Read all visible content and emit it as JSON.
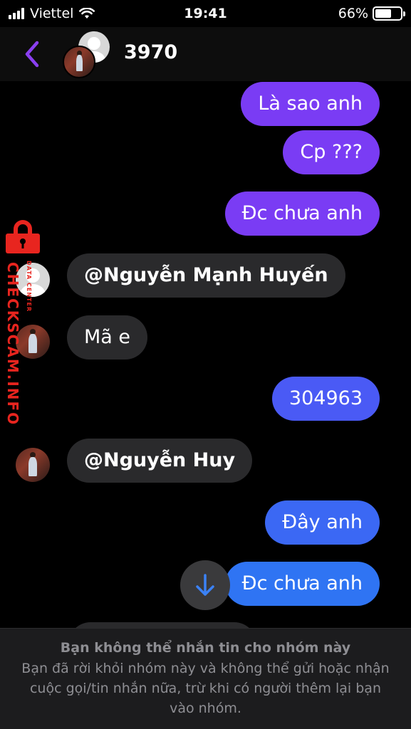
{
  "status_bar": {
    "carrier": "Viettel",
    "time": "19:41",
    "battery": "66%",
    "battery_level": 0.66
  },
  "header": {
    "title": "3970",
    "back_icon": "chevron-left-icon"
  },
  "messages": [
    {
      "side": "outgoing",
      "text": "Là sao anh"
    },
    {
      "side": "outgoing",
      "text": "Cp ???"
    },
    {
      "side": "outgoing",
      "text": "Đc chưa anh"
    },
    {
      "side": "incoming",
      "text": "@Nguyễn Mạnh Huyến"
    },
    {
      "side": "incoming",
      "text": "Mã e"
    },
    {
      "side": "outgoing",
      "text": "304963"
    },
    {
      "side": "incoming",
      "text": "@Nguyễn Huy"
    },
    {
      "side": "outgoing",
      "text": "Đây anh"
    },
    {
      "side": "outgoing",
      "text": "Đc chưa anh"
    }
  ],
  "watermark": {
    "brand": "CHECKSCAM.INFO",
    "sub": "DATA CENTER"
  },
  "footer": {
    "title": "Bạn không thể nhắn tin cho nhóm này",
    "body": "Bạn đã rời khỏi nhóm này và không thể gửi hoặc nhận cuộc gọi/tin nhắn nữa, trừ khi có người thêm lại bạn vào nhóm."
  },
  "colors": {
    "accent": "#7a3cf4",
    "bubble_incoming": "#2a2a2c",
    "watermark_red": "#e8251f",
    "background": "#000000"
  }
}
